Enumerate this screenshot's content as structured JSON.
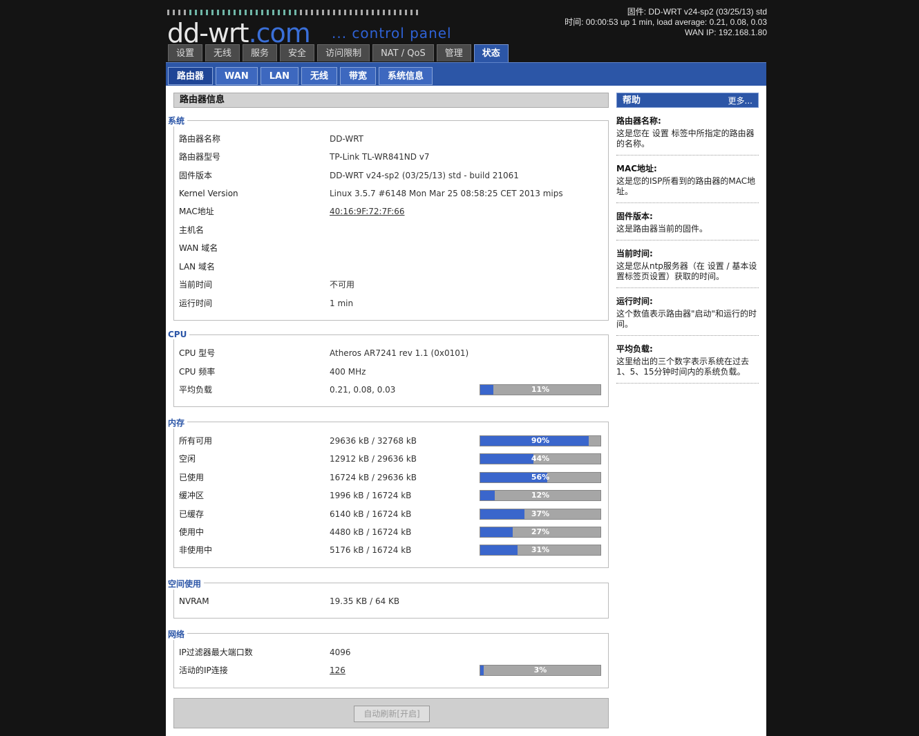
{
  "header": {
    "logo_main": "dd-wrt",
    "logo_suffix": ".com",
    "tagline": "... control panel",
    "firmware_line": "固件: DD-WRT v24-sp2 (03/25/13) std",
    "time_line": "时间: 00:00:53 up 1 min, load average: 0.21, 0.08, 0.03",
    "wan_ip_line": "WAN IP: 192.168.1.80"
  },
  "tabs": [
    "设置",
    "无线",
    "服务",
    "安全",
    "访问限制",
    "NAT / QoS",
    "管理",
    "状态"
  ],
  "active_tab": "状态",
  "subtabs": [
    "路由器",
    "WAN",
    "LAN",
    "无线",
    "带宽",
    "系统信息"
  ],
  "active_subtab": "路由器",
  "main": {
    "title": "路由器信息",
    "system": {
      "legend": "系统",
      "rows": [
        {
          "label": "路由器名称",
          "value": "DD-WRT"
        },
        {
          "label": "路由器型号",
          "value": "TP-Link TL-WR841ND v7"
        },
        {
          "label": "固件版本",
          "value": "DD-WRT v24-sp2 (03/25/13) std - build 21061"
        },
        {
          "label": "Kernel Version",
          "value": "Linux 3.5.7 #6148 Mon Mar 25 08:58:25 CET 2013 mips"
        },
        {
          "label": "MAC地址",
          "value": "40:16:9F:72:7F:66"
        },
        {
          "label": "主机名",
          "value": ""
        },
        {
          "label": "WAN 域名",
          "value": ""
        },
        {
          "label": "LAN 域名",
          "value": ""
        },
        {
          "label": "当前时间",
          "value": "不可用"
        },
        {
          "label": "运行时间",
          "value": "1 min"
        }
      ]
    },
    "cpu": {
      "legend": "CPU",
      "rows": [
        {
          "label": "CPU 型号",
          "value": "Atheros AR7241 rev 1.1 (0x0101)"
        },
        {
          "label": "CPU 频率",
          "value": "400 MHz"
        },
        {
          "label": "平均负载",
          "value": "0.21, 0.08, 0.03",
          "percent": 11,
          "percent_label": "11%"
        }
      ]
    },
    "memory": {
      "legend": "内存",
      "rows": [
        {
          "label": "所有可用",
          "value": "29636 kB / 32768 kB",
          "percent": 90,
          "percent_label": "90%"
        },
        {
          "label": "空闲",
          "value": "12912 kB / 29636 kB",
          "percent": 44,
          "percent_label": "44%"
        },
        {
          "label": "已使用",
          "value": "16724 kB / 29636 kB",
          "percent": 56,
          "percent_label": "56%"
        },
        {
          "label": "缓冲区",
          "value": "1996 kB / 16724 kB",
          "percent": 12,
          "percent_label": "12%"
        },
        {
          "label": "已缓存",
          "value": "6140 kB / 16724 kB",
          "percent": 37,
          "percent_label": "37%"
        },
        {
          "label": "使用中",
          "value": "4480 kB / 16724 kB",
          "percent": 27,
          "percent_label": "27%"
        },
        {
          "label": "非使用中",
          "value": "5176 kB / 16724 kB",
          "percent": 31,
          "percent_label": "31%"
        }
      ]
    },
    "space": {
      "legend": "空间使用",
      "rows": [
        {
          "label": "NVRAM",
          "value": "19.35 KB / 64 KB"
        }
      ]
    },
    "network": {
      "legend": "网络",
      "rows": [
        {
          "label": "IP过滤器最大端口数",
          "value": "4096"
        },
        {
          "label": "活动的IP连接",
          "value": "126",
          "percent": 3,
          "percent_label": "3%"
        }
      ]
    },
    "refresh_button": "自动刷新[开启]"
  },
  "help": {
    "title": "帮助",
    "more": "更多...",
    "items": [
      {
        "title": "路由器名称:",
        "desc": "这是您在 设置 标签中所指定的路由器的名称。"
      },
      {
        "title": "MAC地址:",
        "desc": "这是您的ISP所看到的路由器的MAC地址。"
      },
      {
        "title": "固件版本:",
        "desc": "这是路由器当前的固件。"
      },
      {
        "title": "当前时间:",
        "desc": "这是您从ntp服务器（在 设置 / 基本设置标签页设置）获取的时间。"
      },
      {
        "title": "运行时间:",
        "desc": "这个数值表示路由器\"启动\"和运行的时间。"
      },
      {
        "title": "平均负载:",
        "desc": "这里给出的三个数字表示系统在过去1、5、15分钟时间内的系统负载。"
      }
    ]
  }
}
